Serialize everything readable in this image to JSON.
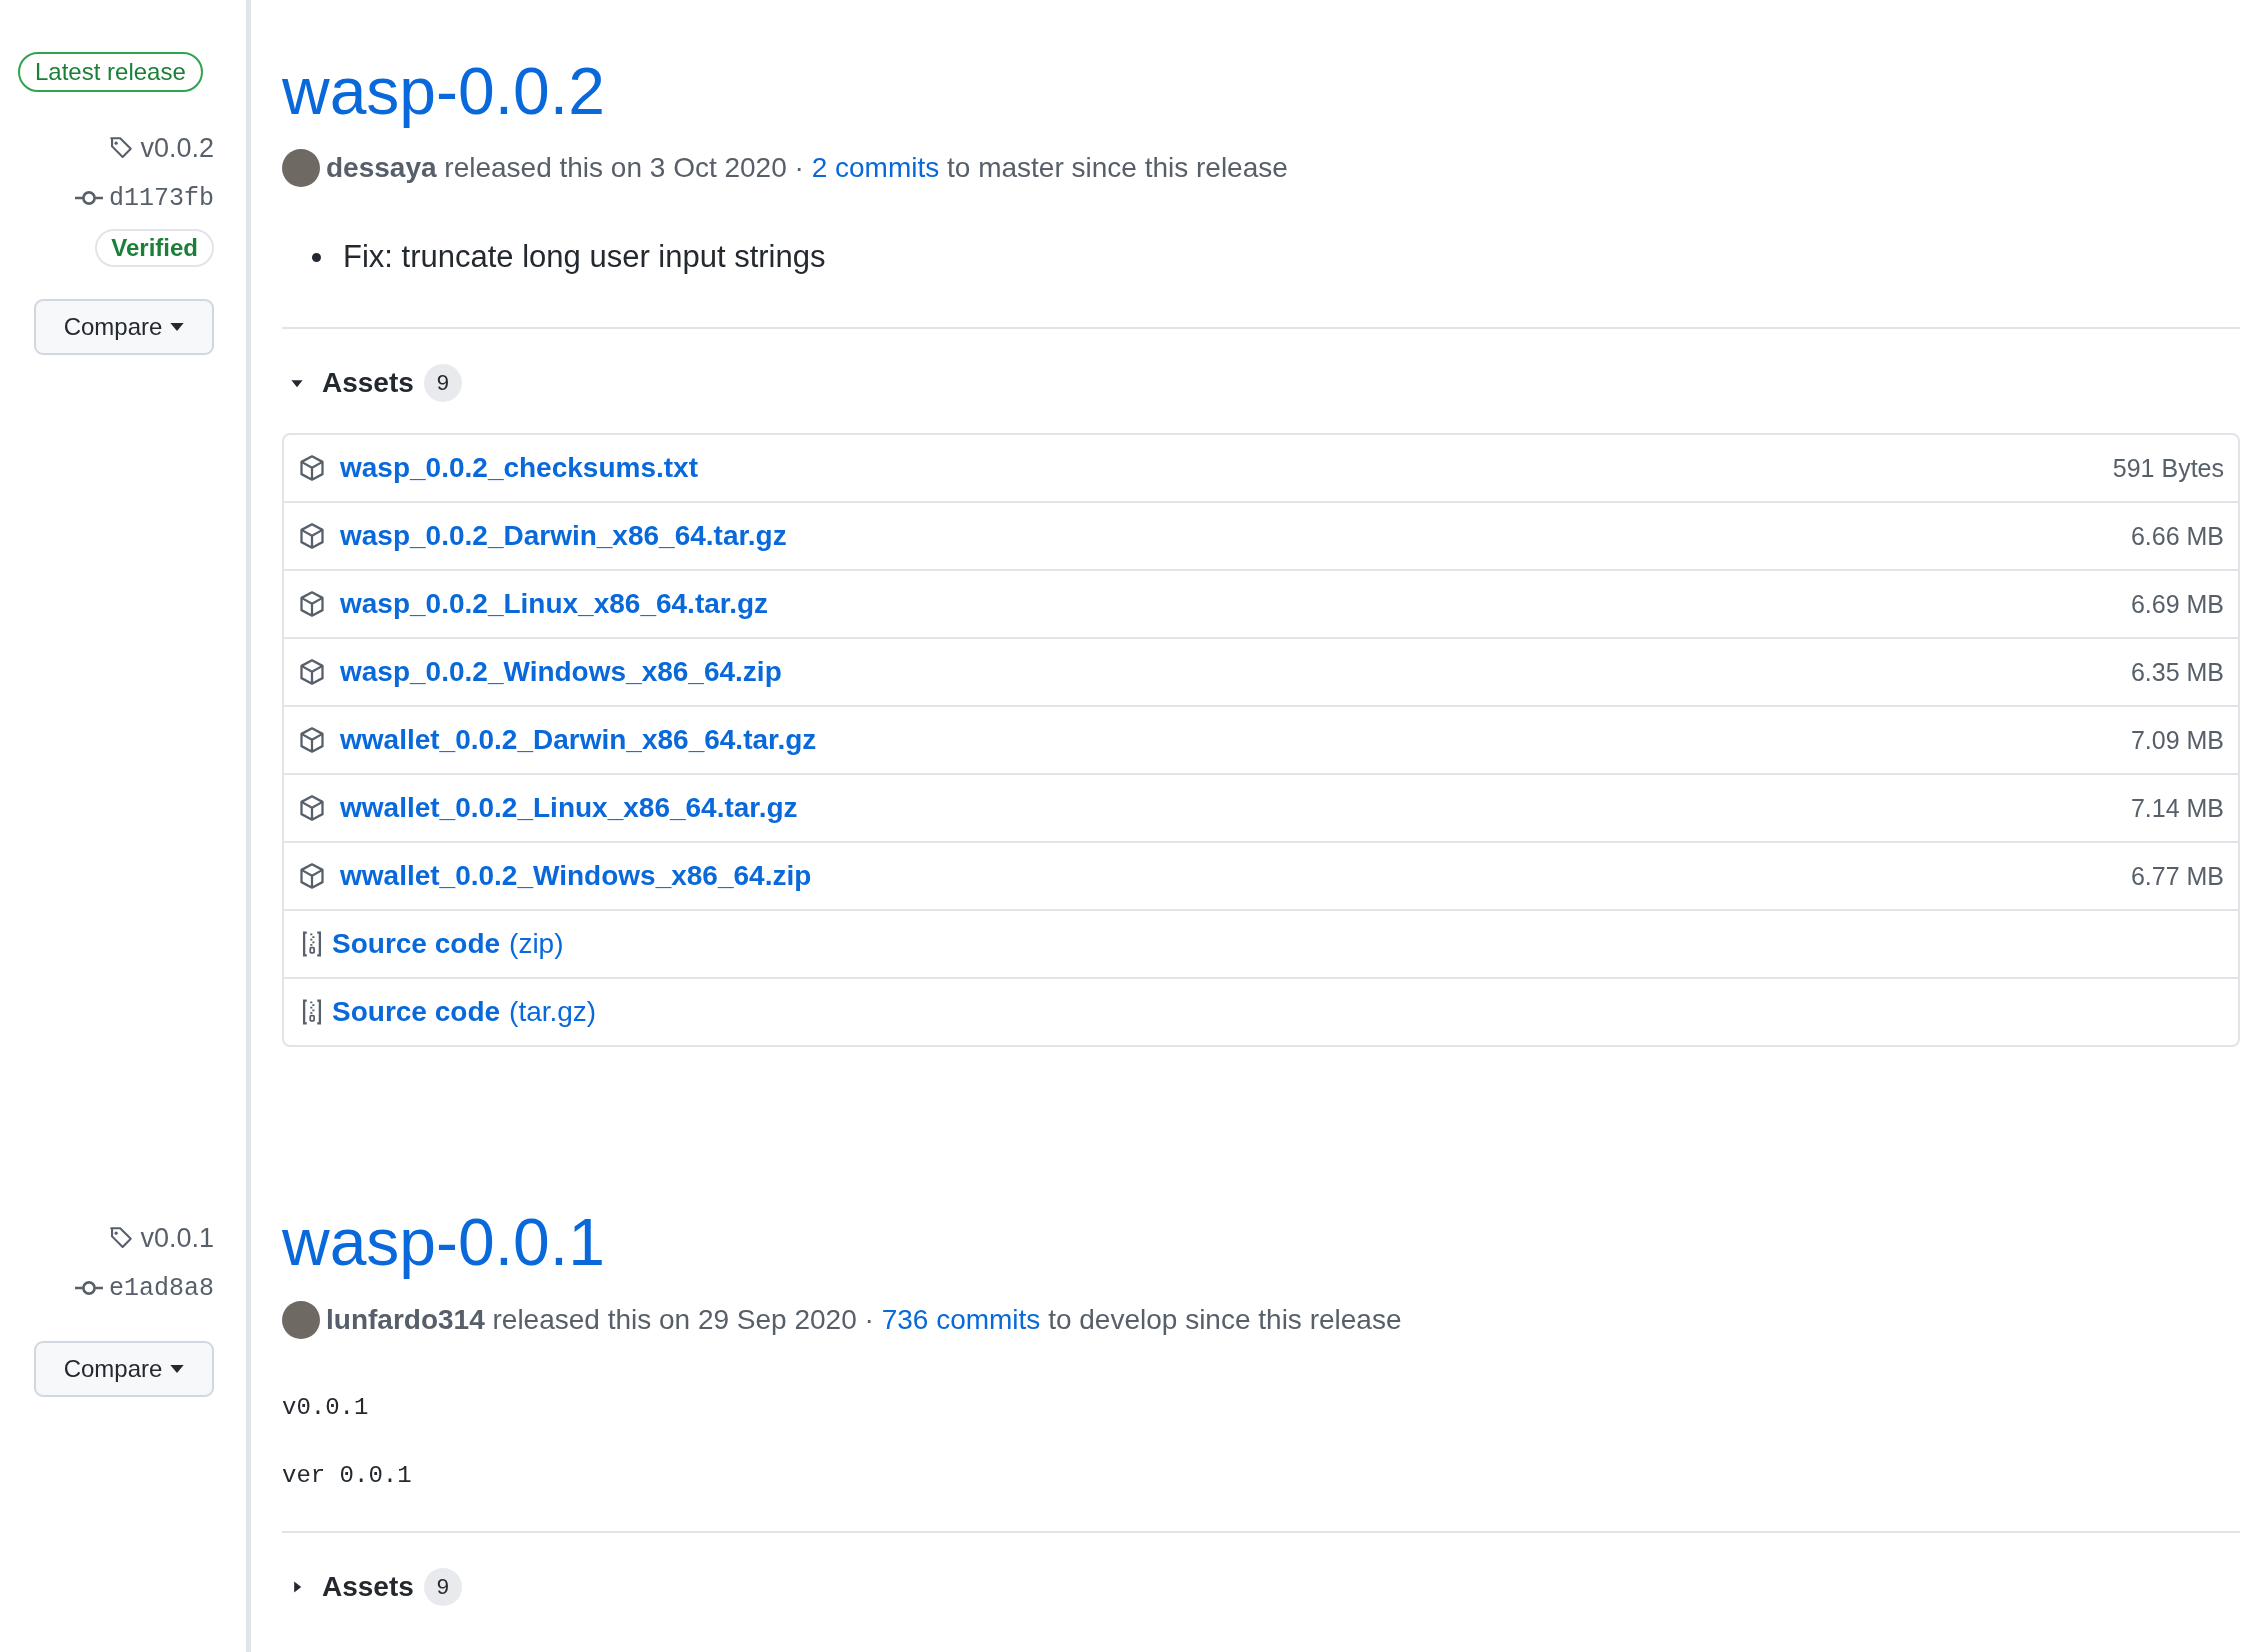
{
  "releases": [
    {
      "latest_label": "Latest release",
      "tag": "v0.0.2",
      "commit": "d1173fb",
      "verified_label": "Verified",
      "compare": "Compare",
      "title": "wasp-0.0.2",
      "author": "dessaya",
      "released": "released this on 3 Oct 2020 ·",
      "commits": "2 commits",
      "since": "to master since this release",
      "notes": [
        "Fix: truncate long user input strings"
      ],
      "assets": {
        "label": "Assets",
        "count": "9",
        "expanded": true,
        "items": [
          {
            "kind": "package",
            "name": "wasp_0.0.2_checksums.txt",
            "size": "591 Bytes"
          },
          {
            "kind": "package",
            "name": "wasp_0.0.2_Darwin_x86_64.tar.gz",
            "size": "6.66 MB"
          },
          {
            "kind": "package",
            "name": "wasp_0.0.2_Linux_x86_64.tar.gz",
            "size": "6.69 MB"
          },
          {
            "kind": "package",
            "name": "wasp_0.0.2_Windows_x86_64.zip",
            "size": "6.35 MB"
          },
          {
            "kind": "package",
            "name": "wwallet_0.0.2_Darwin_x86_64.tar.gz",
            "size": "7.09 MB"
          },
          {
            "kind": "package",
            "name": "wwallet_0.0.2_Linux_x86_64.tar.gz",
            "size": "7.14 MB"
          },
          {
            "kind": "package",
            "name": "wwallet_0.0.2_Windows_x86_64.zip",
            "size": "6.77 MB"
          },
          {
            "kind": "source",
            "name": "Source code",
            "format": "(zip)"
          },
          {
            "kind": "source",
            "name": "Source code",
            "format": "(tar.gz)"
          }
        ]
      }
    },
    {
      "tag": "v0.0.1",
      "commit": "e1ad8a8",
      "compare": "Compare",
      "title": "wasp-0.0.1",
      "author": "lunfardo314",
      "released": "released this on 29 Sep 2020 ·",
      "commits": "736 commits",
      "since": "to develop since this release",
      "code_lines": [
        "v0.0.1",
        "ver 0.0.1"
      ],
      "assets": {
        "label": "Assets",
        "count": "9",
        "expanded": false
      }
    }
  ]
}
